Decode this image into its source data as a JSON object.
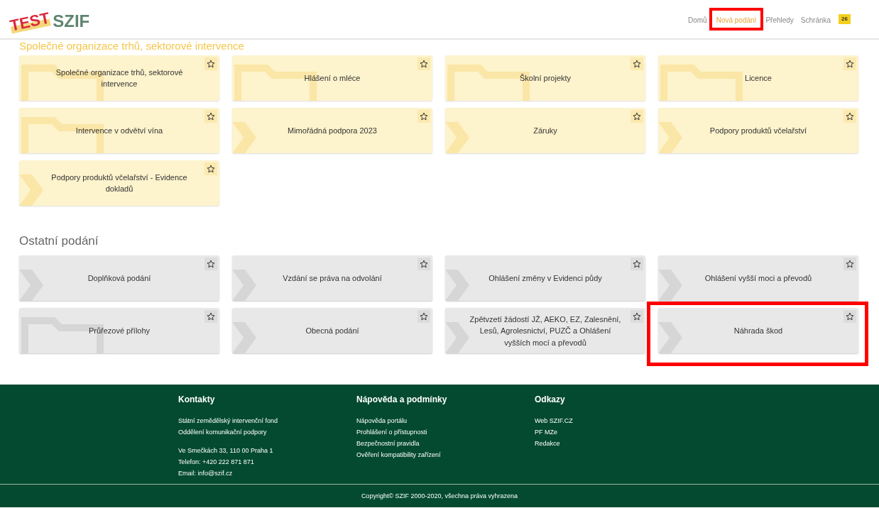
{
  "header": {
    "logo": {
      "badge": "TEST",
      "name": "SZIF"
    },
    "nav": [
      {
        "label": "Domů",
        "selected": false,
        "highlighted": false
      },
      {
        "label": "Nová podání",
        "selected": true,
        "highlighted": true
      },
      {
        "label": "Přehledy",
        "selected": false,
        "highlighted": false
      },
      {
        "label": "Schránka",
        "selected": false,
        "highlighted": false,
        "count": "26"
      }
    ]
  },
  "sections": [
    {
      "title": "Společné organizace trhů, sektorové intervence",
      "kind": "market",
      "tiles": [
        {
          "label": "Společné organizace trhů, sektorové intervence",
          "kind": "folder",
          "highlighted": false
        },
        {
          "label": "Hlášení o mléce",
          "kind": "folder",
          "highlighted": false
        },
        {
          "label": "Školní projekty",
          "kind": "folder",
          "highlighted": false
        },
        {
          "label": "Licence",
          "kind": "folder",
          "highlighted": false
        },
        {
          "label": "Intervence v odvětví vína",
          "kind": "folder",
          "highlighted": false
        },
        {
          "label": "Mimořádná podpora 2023",
          "kind": "chevron",
          "highlighted": false
        },
        {
          "label": "Záruky",
          "kind": "chevron",
          "highlighted": false
        },
        {
          "label": "Podpory produktů včelařství",
          "kind": "chevron",
          "highlighted": false
        },
        {
          "label": "Podpory produktů včelařství - Evidence dokladů",
          "kind": "chevron",
          "highlighted": false
        }
      ]
    },
    {
      "title": "Ostatní podání",
      "kind": "other",
      "tiles": [
        {
          "label": "Doplňková podání",
          "kind": "chevron",
          "highlighted": false
        },
        {
          "label": "Vzdání se práva na odvolání",
          "kind": "chevron",
          "highlighted": false
        },
        {
          "label": "Ohlášení změny v Evidenci půdy",
          "kind": "chevron",
          "highlighted": false
        },
        {
          "label": "Ohlášení vyšší moci a převodů",
          "kind": "chevron",
          "highlighted": false
        },
        {
          "label": "Průřezové přílohy",
          "kind": "folder",
          "highlighted": false
        },
        {
          "label": "Obecná podání",
          "kind": "chevron",
          "highlighted": false
        },
        {
          "label": "Zpětvzetí žádostí JŽ, AEKO, EZ, Zalesnění, Lesů, Agrolesnictví, PUZČ a Ohlášení vyšších mocí a převodů",
          "kind": "chevron",
          "highlighted": false
        },
        {
          "label": "Náhrada škod",
          "kind": "chevron",
          "highlighted": true
        }
      ]
    }
  ],
  "footer": {
    "columns": [
      {
        "title": "Kontakty",
        "groups": [
          [
            "Státní zemědělský intervenční fond",
            "Oddělení komunikační podpory"
          ],
          [
            "Ve Smečkách 33, 110 00 Praha 1",
            "Telefon: +420 222 871 871",
            "Email: info@szif.cz"
          ]
        ]
      },
      {
        "title": "Nápověda a podmínky",
        "groups": [
          [
            "Nápověda portálu",
            "Prohlášení o přístupnosti",
            "Bezpečnostní pravidla",
            "Ověření kompatibility zařízení"
          ]
        ]
      },
      {
        "title": "Odkazy",
        "groups": [
          [
            "Web SZIF.CZ",
            "PF MZe",
            "Redakce"
          ]
        ]
      }
    ],
    "copyright": "Copyright© SZIF 2000-2020, všechna práva vyhrazena"
  }
}
